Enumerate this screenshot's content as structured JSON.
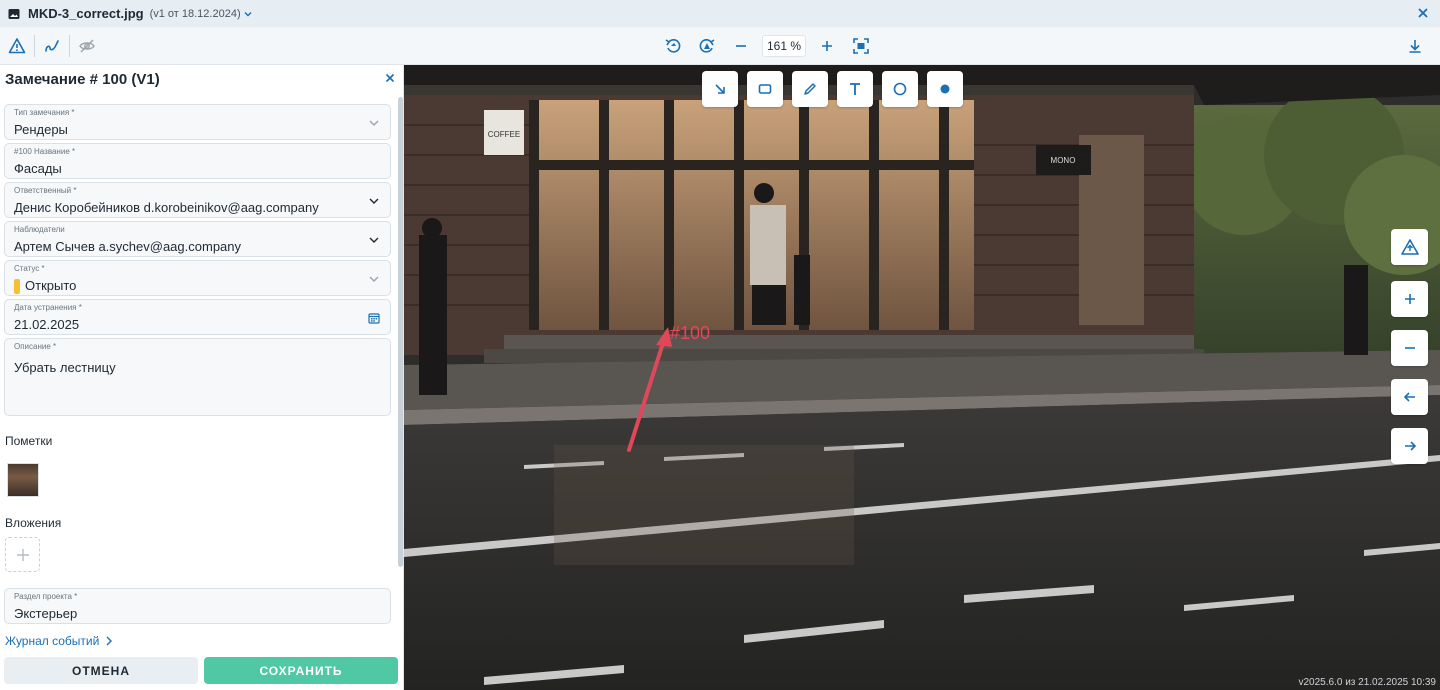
{
  "titlebar": {
    "filename": "MKD-3_correct.jpg",
    "version": "(v1 от 18.12.2024)"
  },
  "toolbar": {
    "zoom": "161 %"
  },
  "panel": {
    "title": "Замечание # 100 (V1)",
    "fields": {
      "type": {
        "label": "Тип замечания *",
        "value": "Рендеры"
      },
      "name": {
        "label": "#100 Название *",
        "value": "Фасады"
      },
      "responsible": {
        "label": "Ответственный *",
        "value": "Денис Коробейников d.korobeinikov@aag.company"
      },
      "observers": {
        "label": "Наблюдатели",
        "value": "Артем Сычев a.sychev@aag.company"
      },
      "status": {
        "label": "Статус *",
        "value": "Открыто",
        "color": "#f2c230"
      },
      "due_date": {
        "label": "Дата устранения *",
        "value": "21.02.2025"
      },
      "description": {
        "label": "Описание *",
        "value": "Убрать лестницу"
      },
      "section": {
        "label": "Раздел проекта *",
        "value": "Экстерьер"
      }
    },
    "marks_label": "Пометки",
    "attachments_label": "Вложения",
    "journal_label": "Журнал событий",
    "cancel_label": "ОТМЕНА",
    "save_label": "СОХРАНИТЬ"
  },
  "viewer": {
    "marker_label": "#100",
    "sign_coffee": "COFFEE",
    "sign_mono": "MONO",
    "version_footer": "v2025.6.0 из 21.02.2025 10:39",
    "accent_color": "#1a6fb5",
    "annotation_color": "#e0485a"
  }
}
